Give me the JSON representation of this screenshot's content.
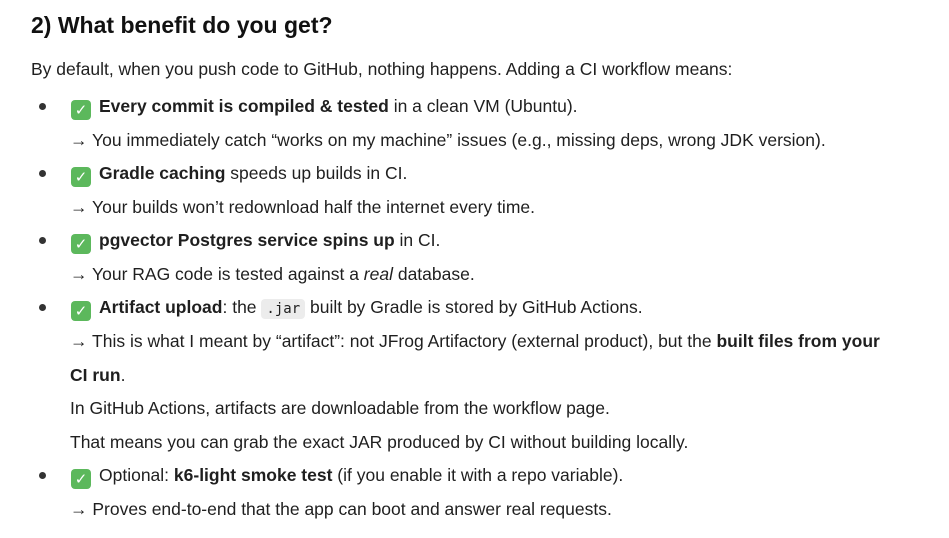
{
  "heading": "2) What benefit do you get?",
  "intro": "By default, when you push code to GitHub, nothing happens. Adding a CI workflow means:",
  "check_glyph": "✓",
  "check_color": "#5cb85c",
  "items": [
    {
      "bold": "Every commit is compiled & tested",
      "rest": " in a clean VM (Ubuntu).",
      "sub": "→ You immediately catch “works on my machine” issues (e.g., missing deps, wrong JDK version)."
    },
    {
      "bold": "Gradle caching",
      "rest": " speeds up builds in CI.",
      "sub": "→ Your builds won’t redownload half the internet every time."
    },
    {
      "bold": "pgvector Postgres service spins up",
      "rest": " in CI.",
      "sub_pre": "→ Your RAG code is tested against a ",
      "sub_italic": "real",
      "sub_post": " database."
    },
    {
      "bold": "Artifact upload",
      "mid": ": the ",
      "code": ".jar",
      "rest": " built by Gradle is stored by GitHub Actions.",
      "sub_pre": "→ This is what I meant by “artifact”: not JFrog Artifactory (external product), but the ",
      "sub_bold": "built files from your",
      "sub_cont_bold": "CI run",
      "sub_cont_rest": ".",
      "line2": "In GitHub Actions, artifacts are downloadable from the workflow page.",
      "line3": "That means you can grab the exact JAR produced by CI without building locally."
    },
    {
      "pre": "Optional: ",
      "bold": "k6-light smoke test",
      "rest": " (if you enable it with a repo variable).",
      "sub": "→ Proves end-to-end that the app can boot and answer real requests."
    }
  ]
}
